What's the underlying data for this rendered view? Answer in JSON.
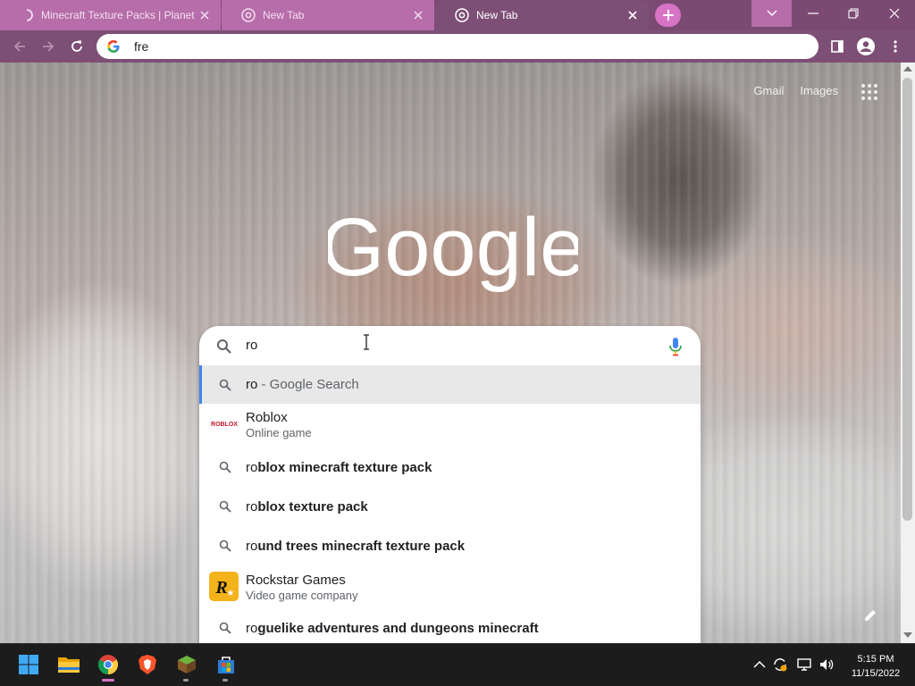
{
  "browser": {
    "tabs": [
      {
        "title": "Minecraft Texture Packs | Planet",
        "state": "loading"
      },
      {
        "title": "New Tab",
        "state": "inactive"
      },
      {
        "title": "New Tab",
        "state": "active"
      }
    ],
    "address_bar": {
      "value": "fre"
    },
    "toolbar_icons": [
      "back-icon",
      "forward-icon",
      "reload-icon",
      "side-panel-icon",
      "profile-icon",
      "menu-icon"
    ],
    "window_controls": [
      "tab-search-icon",
      "minimize-icon",
      "restore-icon",
      "close-icon"
    ]
  },
  "page": {
    "top_links": {
      "gmail": "Gmail",
      "images": "Images"
    },
    "logo": "Google",
    "search": {
      "value": "ro"
    },
    "suggestions": [
      {
        "type": "query",
        "bold_prefix": "ro",
        "rest": " - Google Search",
        "selected": true
      },
      {
        "type": "entity",
        "title": "Roblox",
        "subtitle": "Online game",
        "image": "roblox-logo"
      },
      {
        "type": "query",
        "prefix": "ro",
        "rest": "blox minecraft texture pack"
      },
      {
        "type": "query",
        "prefix": "ro",
        "rest": "blox texture pack"
      },
      {
        "type": "query",
        "prefix": "ro",
        "rest": "und trees minecraft texture pack"
      },
      {
        "type": "entity",
        "title": "Rockstar Games",
        "subtitle": "Video game company",
        "image": "rockstar-logo"
      },
      {
        "type": "query",
        "prefix": "ro",
        "rest": "guelike adventures and dungeons minecraft"
      }
    ]
  },
  "taskbar": {
    "apps": [
      "windows-start-icon",
      "file-explorer-icon",
      "chrome-icon",
      "brave-icon",
      "minecraft-icon",
      "microsoft-store-icon"
    ],
    "tray": [
      "chevron-up-icon",
      "sync-icon",
      "network-icon",
      "volume-icon"
    ],
    "time": "5:15 PM",
    "date": "11/15/2022"
  },
  "colors": {
    "tab_strip": "#7b4a73",
    "toolbar": "#7e4f76",
    "new_tab_button": "#d774c6",
    "selection_bar": "#4285f4"
  }
}
